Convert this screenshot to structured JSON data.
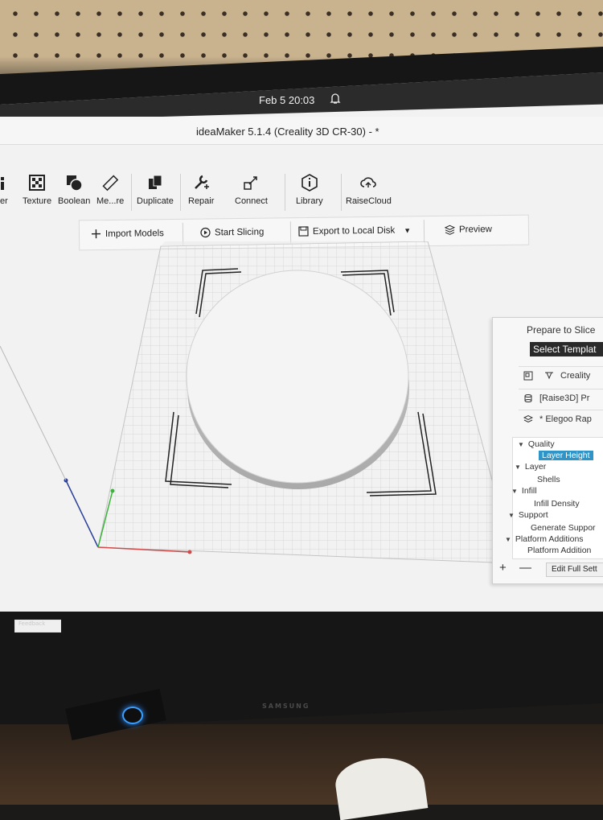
{
  "system_bar": {
    "date_time": "Feb 5  20:03"
  },
  "window": {
    "title": "ideaMaker 5.1.4 (Creality 3D CR-30) - *"
  },
  "toolbar": {
    "items": [
      {
        "label": "difier",
        "icon": "modifier-icon"
      },
      {
        "label": "Texture",
        "icon": "texture-icon"
      },
      {
        "label": "Boolean",
        "icon": "boolean-icon"
      },
      {
        "label": "Me...re",
        "icon": "measure-icon"
      },
      {
        "label": "Duplicate",
        "icon": "duplicate-icon"
      },
      {
        "label": "Repair",
        "icon": "repair-icon"
      },
      {
        "label": "Connect",
        "icon": "connect-icon"
      },
      {
        "label": "Library",
        "icon": "library-icon"
      },
      {
        "label": "RaiseCloud",
        "icon": "cloud-icon"
      }
    ]
  },
  "actions": {
    "import": "Import Models",
    "slice": "Start Slicing",
    "export": "Export to Local Disk",
    "preview": "Preview"
  },
  "prepare_panel": {
    "title": "Prepare to Slice",
    "select_template": "Select Templat",
    "printer": "Creality",
    "material": "[Raise3D] Pr",
    "profile": "* Elegoo Rap",
    "tree": [
      "Quality",
      "Layer Height",
      "Layer",
      "Shells",
      "Infill",
      "Infill Density",
      "Support",
      "Generate Suppor",
      "Platform Additions",
      "Platform Addition"
    ],
    "edit_full": "Edit Full Sett"
  },
  "status": {
    "feedback": "Feedback"
  },
  "monitor": {
    "brand": "SAMSUNG"
  },
  "colors": {
    "accent": "#2f95c8",
    "dark": "#2b2b2b",
    "grid": "#d8d8d8"
  }
}
